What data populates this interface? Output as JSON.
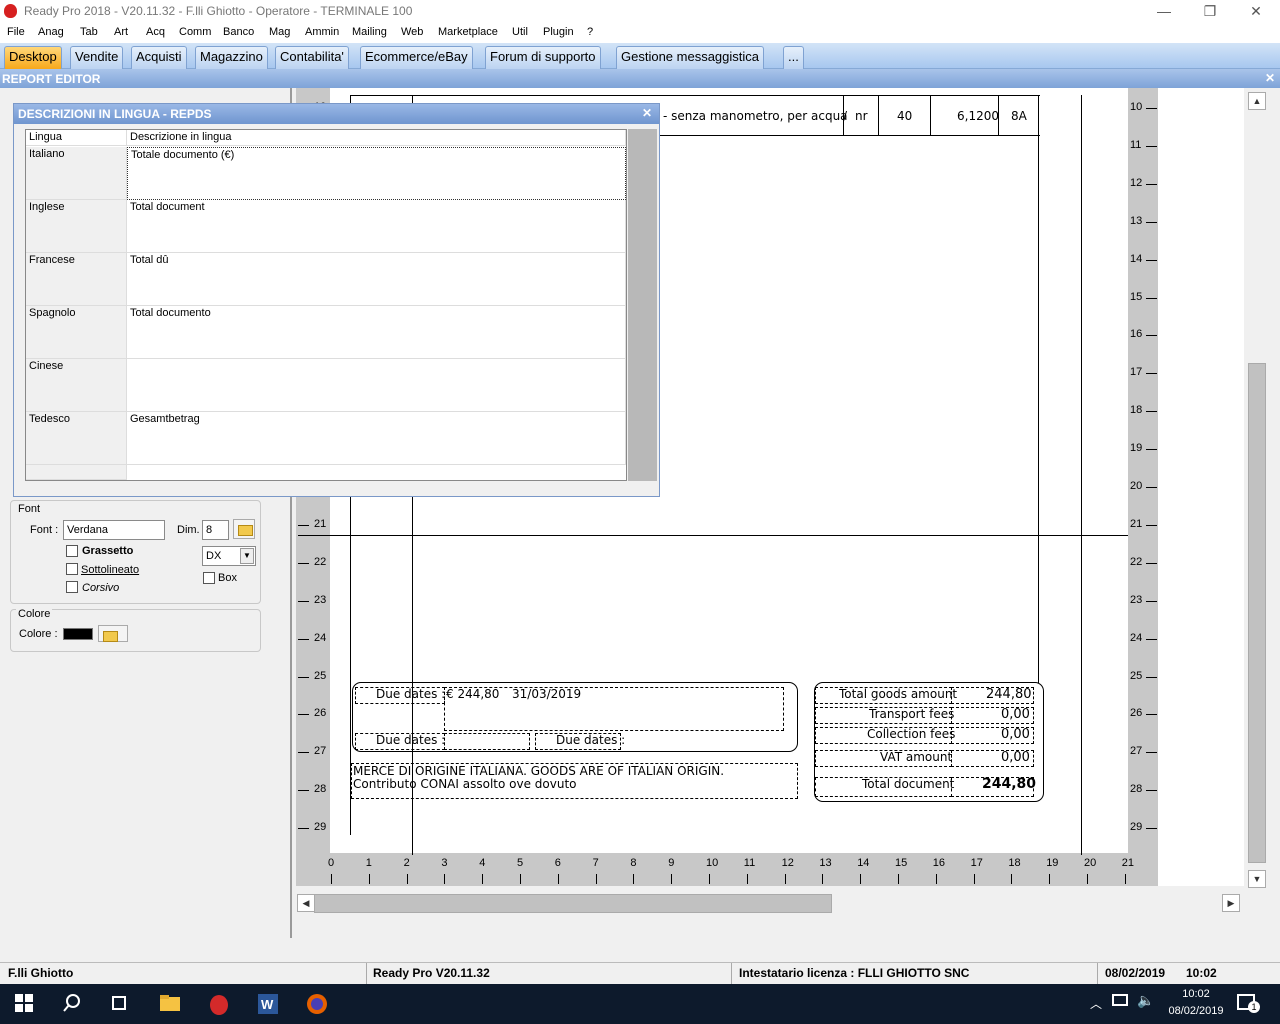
{
  "window": {
    "title": "Ready Pro 2018 - V20.11.32 - F.lli Ghiotto - Operatore - TERMINALE 100",
    "minimize": "—",
    "restore": "❐",
    "close": "✕"
  },
  "menu": [
    "File",
    "Anag",
    "Tab",
    "Art",
    "Acq",
    "Comm",
    "Banco",
    "Mag",
    "Ammin",
    "Mailing",
    "Web",
    "Marketplace",
    "Util",
    "Plugin",
    "?"
  ],
  "tabs": [
    "Desktop",
    "Vendite",
    "Acquisti",
    "Magazzino",
    "Contabilita'",
    "Ecommerce/eBay",
    "Forum di supporto",
    "Gestione messaggistica",
    "..."
  ],
  "report_editor": {
    "title": "REPORT EDITOR",
    "close": "✕"
  },
  "left_panel": {
    "font_group": "Font",
    "font_label": "Font :",
    "font_value": "Verdana",
    "dim_label": "Dim.",
    "dim_value": "8",
    "bold": "Grassetto",
    "underline": "Sottolineato",
    "italic": "Corsivo",
    "align_value": "DX",
    "box": "Box",
    "color_group": "Colore",
    "color_label": "Colore :",
    "color_value": "#000000"
  },
  "dialog": {
    "title": "DESCRIZIONI IN LINGUA - REPDS",
    "close": "✕",
    "col_lang": "Lingua",
    "col_desc": "Descrizione in lingua",
    "rows": [
      {
        "lang": "Italiano",
        "desc": "Totale documento (€)"
      },
      {
        "lang": "Inglese",
        "desc": "Total document"
      },
      {
        "lang": "Francese",
        "desc": "Total dû"
      },
      {
        "lang": "Spagnolo",
        "desc": "Total documento"
      },
      {
        "lang": "Cinese",
        "desc": ""
      },
      {
        "lang": "Tedesco",
        "desc": "Gesamtbetrag"
      }
    ]
  },
  "report": {
    "row_text": "- senza manometro, per acqua",
    "row_sep": "/",
    "row_unit": "nr",
    "row_qty": "40",
    "row_price": "6,1200",
    "row_vat": "8A",
    "due_dates_1": "Due dates :",
    "due_amount": "€ 244,80",
    "due_date": "31/03/2019",
    "due_dates_2": "Due dates :",
    "due_dates_3": "Due dates :",
    "origin_1": "MERCE DI ORIGINE ITALIANA. GOODS ARE OF ITALIAN ORIGIN.",
    "origin_2": "Contributo CONAI assolto ove dovuto",
    "totals": [
      {
        "label": "Total goods amount",
        "value": "244,80"
      },
      {
        "label": "Transport fees",
        "value": "0,00"
      },
      {
        "label": "Collection fees",
        "value": "0,00"
      },
      {
        "label": "VAT amount",
        "value": "0,00"
      },
      {
        "label": "Total document",
        "value": "244,80"
      }
    ]
  },
  "ruler": {
    "vertical": [
      "10",
      "11",
      "12",
      "13",
      "14",
      "15",
      "16",
      "17",
      "18",
      "19",
      "20",
      "21",
      "22",
      "23",
      "24",
      "25",
      "26",
      "27",
      "28",
      "29"
    ],
    "horizontal": [
      "0",
      "1",
      "2",
      "3",
      "4",
      "5",
      "6",
      "7",
      "8",
      "9",
      "10",
      "11",
      "12",
      "13",
      "14",
      "15",
      "16",
      "17",
      "18",
      "19",
      "20",
      "21"
    ]
  },
  "status": {
    "company": "F.lli Ghiotto",
    "version": "Ready Pro V20.11.32",
    "license": "Intestatario licenza : FLLI GHIOTTO SNC",
    "date": "08/02/2019",
    "time": "10:02"
  },
  "taskbar": {
    "time": "10:02",
    "date": "08/02/2019",
    "notifications": "1"
  }
}
